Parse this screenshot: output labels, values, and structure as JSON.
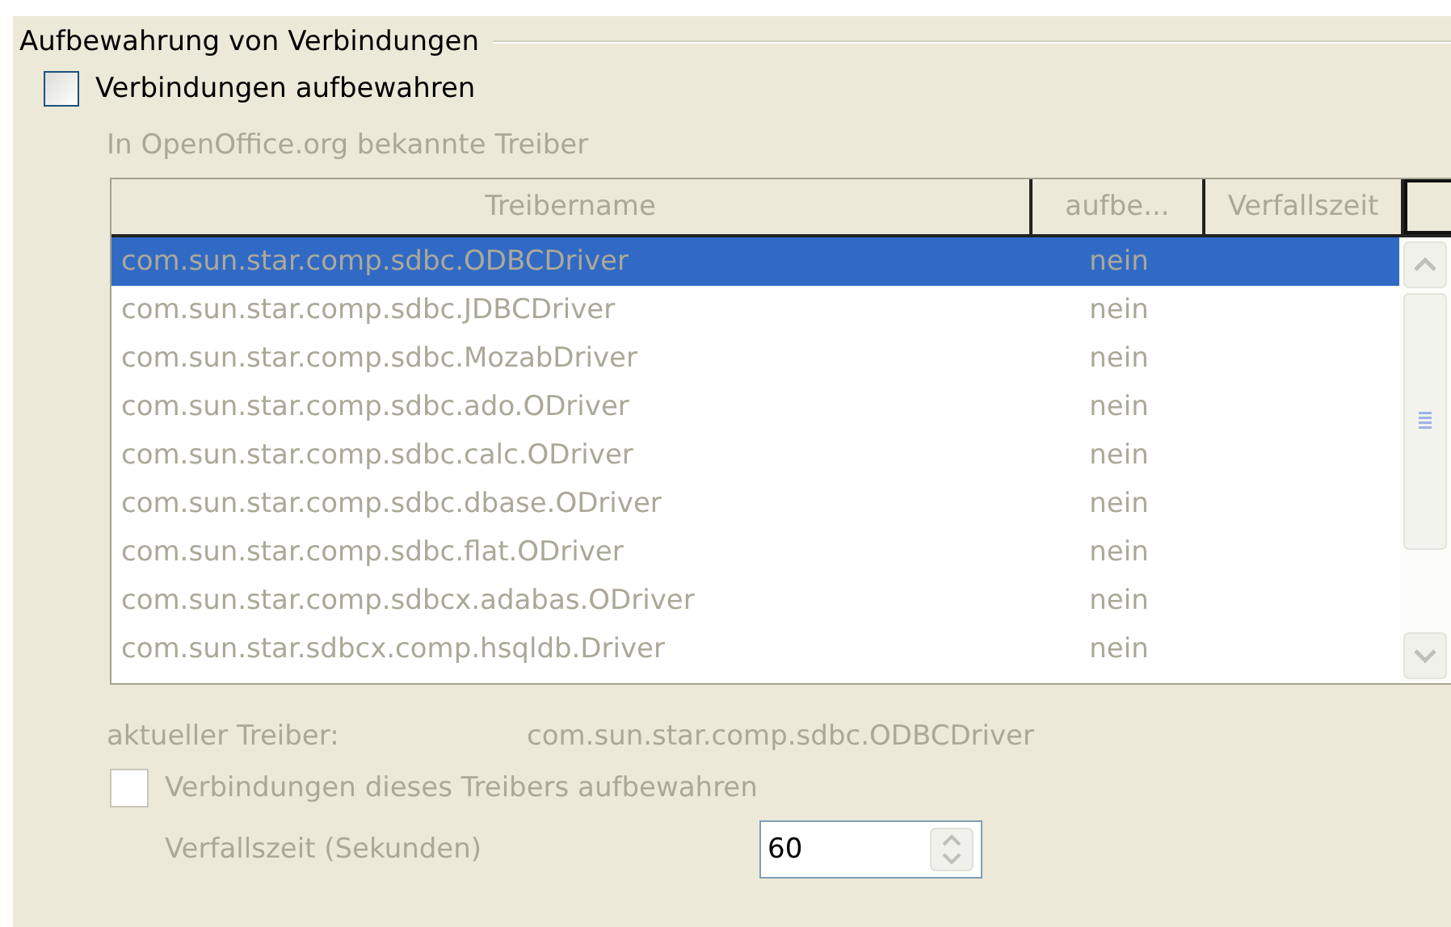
{
  "group": {
    "title": "Aufbewahrung von Verbindungen"
  },
  "pool_checkbox": {
    "label": "Verbindungen aufbewahren",
    "checked": false,
    "disabled": false
  },
  "drivers": {
    "label": "In OpenOffice.org bekannte Treiber",
    "disabled": true,
    "columns": [
      "Treibername",
      "aufbe...",
      "Verfallszeit"
    ],
    "rows": [
      {
        "name": "com.sun.star.comp.sdbc.ODBCDriver",
        "pooled": "nein",
        "selected": true
      },
      {
        "name": "com.sun.star.comp.sdbc.JDBCDriver",
        "pooled": "nein",
        "selected": false
      },
      {
        "name": "com.sun.star.comp.sdbc.MozabDriver",
        "pooled": "nein",
        "selected": false
      },
      {
        "name": "com.sun.star.comp.sdbc.ado.ODriver",
        "pooled": "nein",
        "selected": false
      },
      {
        "name": "com.sun.star.comp.sdbc.calc.ODriver",
        "pooled": "nein",
        "selected": false
      },
      {
        "name": "com.sun.star.comp.sdbc.dbase.ODriver",
        "pooled": "nein",
        "selected": false
      },
      {
        "name": "com.sun.star.comp.sdbc.flat.ODriver",
        "pooled": "nein",
        "selected": false
      },
      {
        "name": "com.sun.star.comp.sdbcx.adabas.ODriver",
        "pooled": "nein",
        "selected": false
      },
      {
        "name": "com.sun.star.sdbcx.comp.hsqldb.Driver",
        "pooled": "nein",
        "selected": false
      }
    ]
  },
  "current_driver": {
    "label": "aktueller Treiber:",
    "value": "com.sun.star.comp.sdbc.ODBCDriver"
  },
  "driver_checkbox": {
    "label": "Verbindungen dieses Treibers aufbewahren",
    "checked": false,
    "disabled": true
  },
  "timeout": {
    "label": "Verfallszeit (Sekunden)",
    "value": "60"
  }
}
